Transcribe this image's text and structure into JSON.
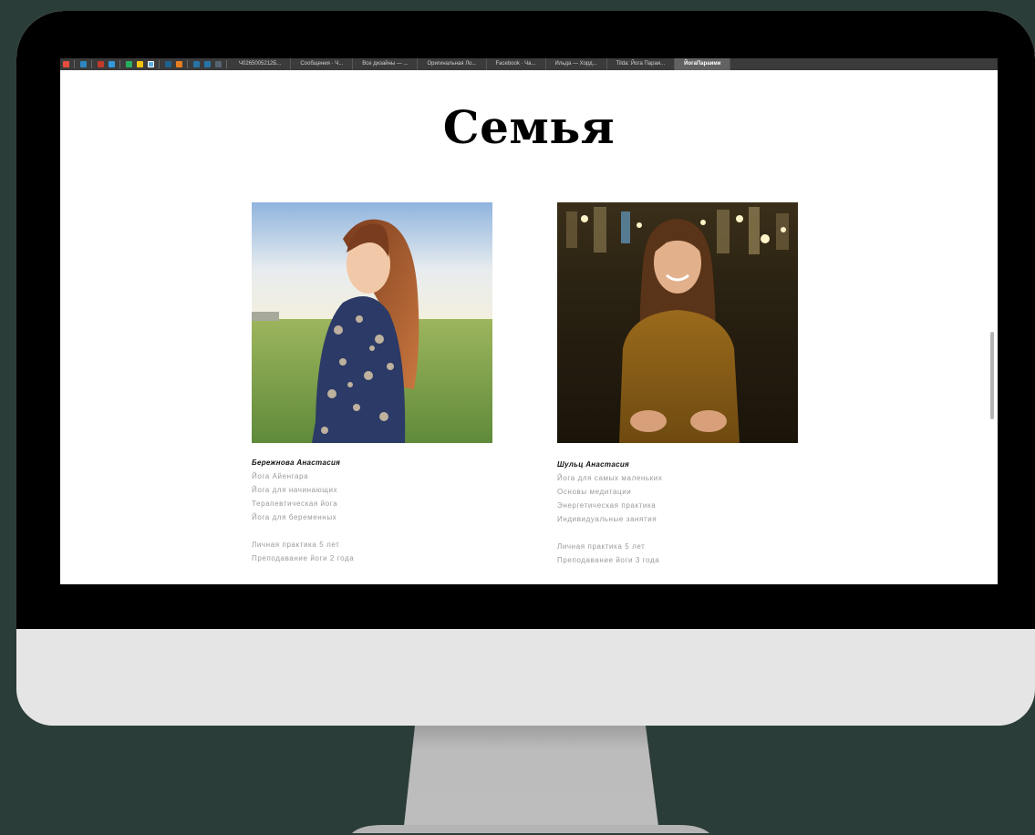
{
  "browser": {
    "tabs": [
      {
        "label": "Ч0265005212Б..."
      },
      {
        "label": "Сообщения · Ч..."
      },
      {
        "label": "Все дизайны — ..."
      },
      {
        "label": "Оригинальная Ло..."
      },
      {
        "label": "Facebook · Ча..."
      },
      {
        "label": "Ильда — Хорд..."
      },
      {
        "label": "Tilda: Йога Параи..."
      },
      {
        "label": "ЙогаПараими",
        "active": true
      }
    ]
  },
  "page": {
    "title": "Семья",
    "members": [
      {
        "name": "Бережнова Анастасия",
        "practices": [
          "Йога Айенгара",
          "Йога для начинающих",
          "Терапевтическая йога",
          "Йога для беременных"
        ],
        "experience": [
          "Личная практика 5 лет",
          "Преподавание йоги 2 года"
        ]
      },
      {
        "name": "Шульц Анастасия",
        "practices": [
          "Йога для самых маленьких",
          "Основы медитации",
          "Энергетическая практика",
          "Индивидуальные занятия"
        ],
        "experience": [
          "Личная практика 5 лет",
          "Преподавание йоги 3 года"
        ]
      }
    ]
  },
  "colors": {
    "background": "#2b3d38",
    "monitor_frame": "#000000",
    "monitor_chin": "#e5e5e5",
    "stand": "#b4b4b4"
  }
}
